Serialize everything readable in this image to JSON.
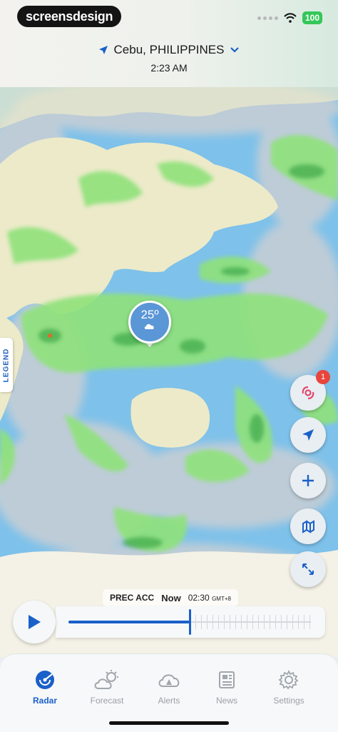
{
  "status_bar": {
    "brand": "screensdesign",
    "battery": "100"
  },
  "location": {
    "name": "Cebu, PHILIPPINES",
    "time": "2:23 AM"
  },
  "map": {
    "legend_label": "LEGEND",
    "temperature": "25º",
    "condition_icon": "cloud-night-icon",
    "storm_badge_count": "1"
  },
  "map_controls": [
    {
      "name": "storm-tracker",
      "icon": "hurricane-icon"
    },
    {
      "name": "my-location",
      "icon": "location-arrow-icon"
    },
    {
      "name": "zoom-in",
      "icon": "plus-icon"
    },
    {
      "name": "layers",
      "icon": "layers-icon"
    },
    {
      "name": "fullscreen",
      "icon": "expand-icon"
    }
  ],
  "timeline": {
    "layer_label": "PREC ACC",
    "now_label": "Now",
    "time": "02:30",
    "timezone": "GMT+8",
    "progress": 0.5
  },
  "tabs": [
    {
      "label": "Radar",
      "icon": "radar-icon",
      "active": true
    },
    {
      "label": "Forecast",
      "icon": "forecast-icon",
      "active": false
    },
    {
      "label": "Alerts",
      "icon": "alerts-icon",
      "active": false
    },
    {
      "label": "News",
      "icon": "news-icon",
      "active": false
    },
    {
      "label": "Settings",
      "icon": "gear-icon",
      "active": false
    }
  ],
  "colors": {
    "accent": "#1a60c9",
    "ocean": "#7ec1ea",
    "land": "#eceac9",
    "rain": "#8fe27a",
    "badge": "#e8453c"
  }
}
